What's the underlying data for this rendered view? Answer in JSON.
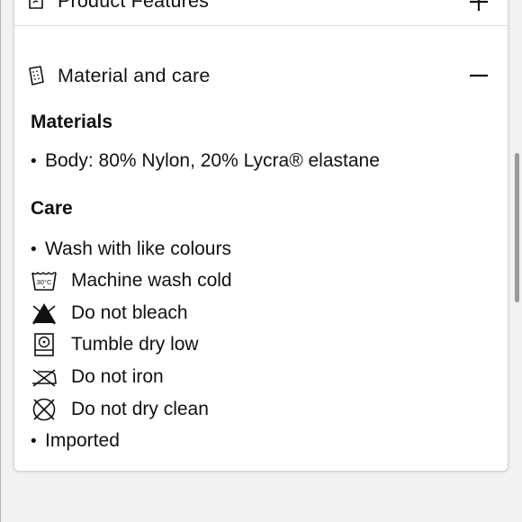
{
  "accordion": {
    "features": {
      "title": "Product Features",
      "icon": "tag-icon",
      "toggle": "plus-icon"
    },
    "material": {
      "title": "Material and care",
      "icon": "fabric-swatch-icon",
      "toggle": "minus-icon"
    }
  },
  "materials": {
    "heading": "Materials",
    "bullet": "•",
    "items": [
      "Body: 80% Nylon, 20% Lycra® elastane"
    ]
  },
  "care": {
    "heading": "Care",
    "bullet": "•",
    "first_item": "Wash with like colours",
    "icon_items": [
      {
        "icon": "machine-wash-cold-icon",
        "label": "Machine wash cold",
        "symbol_text": "30°C"
      },
      {
        "icon": "do-not-bleach-icon",
        "label": "Do not bleach"
      },
      {
        "icon": "tumble-dry-low-icon",
        "label": "Tumble dry low"
      },
      {
        "icon": "do-not-iron-icon",
        "label": "Do not iron"
      },
      {
        "icon": "do-not-dry-clean-icon",
        "label": "Do not dry clean"
      }
    ],
    "last_item": "Imported"
  },
  "colors": {
    "background": "#f2f2f2",
    "card": "#ffffff",
    "text": "#111111",
    "scrollbar": "#9a9a9a"
  }
}
